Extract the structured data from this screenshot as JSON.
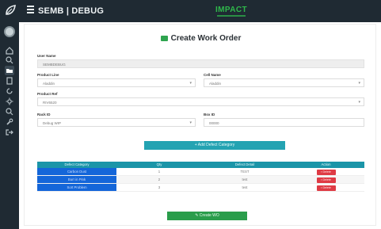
{
  "header": {
    "app_title": "SEMB | DEBUG",
    "brand": "IMPACT"
  },
  "page": {
    "title": "Create Work Order"
  },
  "form": {
    "user_name_label": "User Name",
    "user_name_value": "SEMBDEBUG",
    "product_line_label": "Product Line",
    "product_line_value": "Aladdin",
    "cell_name_label": "Cell Name",
    "cell_name_value": "Aladdin",
    "product_ref_label": "Product Ref",
    "product_ref_value": "RIV6520",
    "rack_id_label": "Rack ID",
    "rack_id_value": "Debug WIP",
    "box_id_label": "Box ID",
    "box_id_value": "00000"
  },
  "actions": {
    "add_defect_label": "+ Add Defect Category",
    "create_wo_label": "Create WO"
  },
  "table": {
    "headers": [
      "Defect Category",
      "Qty",
      "Defect Detail",
      "Action"
    ],
    "rows": [
      {
        "category": "Carbon Dust",
        "qty": "1",
        "detail": "TEST",
        "action": "Delete"
      },
      {
        "category": "Burr in Pink",
        "qty": "2",
        "detail": "test",
        "action": "Delete"
      },
      {
        "category": "Sort Problem",
        "qty": "3",
        "detail": "test",
        "action": "Delete"
      }
    ]
  },
  "colors": {
    "topbar": "#1f2a33",
    "brand": "#2fb84b",
    "teal": "#24a3b2",
    "category_cell": "#1466d9",
    "delete": "#df3b45",
    "create": "#2a9d4b"
  },
  "icons": {
    "logo": "leaf-icon",
    "sidebar": [
      "home-icon",
      "search-icon",
      "folder-icon",
      "file-icon",
      "refresh-icon",
      "settings-icon",
      "search-icon",
      "wrench-icon",
      "logout-icon"
    ]
  }
}
